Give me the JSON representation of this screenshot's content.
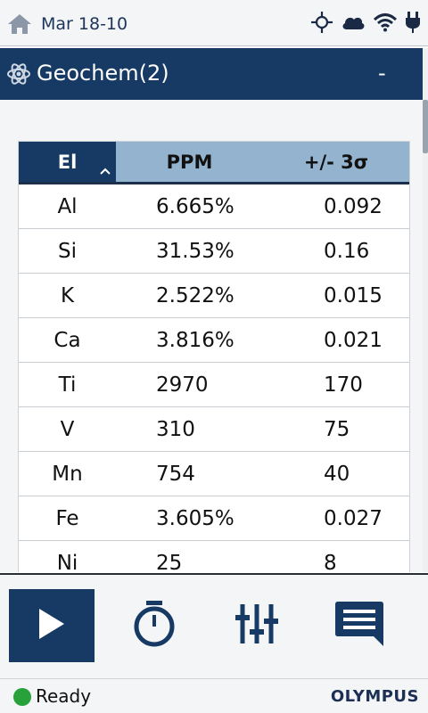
{
  "status_bar": {
    "date": "Mar 18-10",
    "icons": [
      "home-icon",
      "sun-target-icon",
      "cloud-icon",
      "wifi-icon",
      "plug-icon"
    ]
  },
  "title_bar": {
    "title": "Geochem(2)",
    "collapse_label": "-",
    "icon": "atom-icon"
  },
  "table": {
    "headers": [
      "El",
      "PPM",
      "+/- 3σ"
    ],
    "sort_indicator": "^",
    "rows": [
      {
        "el": "Al",
        "ppm": "6.665%",
        "err": "0.092"
      },
      {
        "el": "Si",
        "ppm": "31.53%",
        "err": "0.16"
      },
      {
        "el": "K",
        "ppm": "2.522%",
        "err": "0.015"
      },
      {
        "el": "Ca",
        "ppm": "3.816%",
        "err": "0.021"
      },
      {
        "el": "Ti",
        "ppm": "2970",
        "err": "170"
      },
      {
        "el": "V",
        "ppm": "310",
        "err": "75"
      },
      {
        "el": "Mn",
        "ppm": "754",
        "err": "40"
      },
      {
        "el": "Fe",
        "ppm": "3.605%",
        "err": "0.027"
      },
      {
        "el": "Ni",
        "ppm": "25",
        "err": "8"
      }
    ]
  },
  "toolbar": {
    "buttons": [
      "play-icon",
      "timer-icon",
      "sliders-icon",
      "message-icon"
    ]
  },
  "footer": {
    "status": "Ready",
    "brand": "OLYMPUS",
    "status_color": "#27a13a"
  },
  "colors": {
    "accent": "#173a64",
    "header_light": "#93b3cf"
  }
}
